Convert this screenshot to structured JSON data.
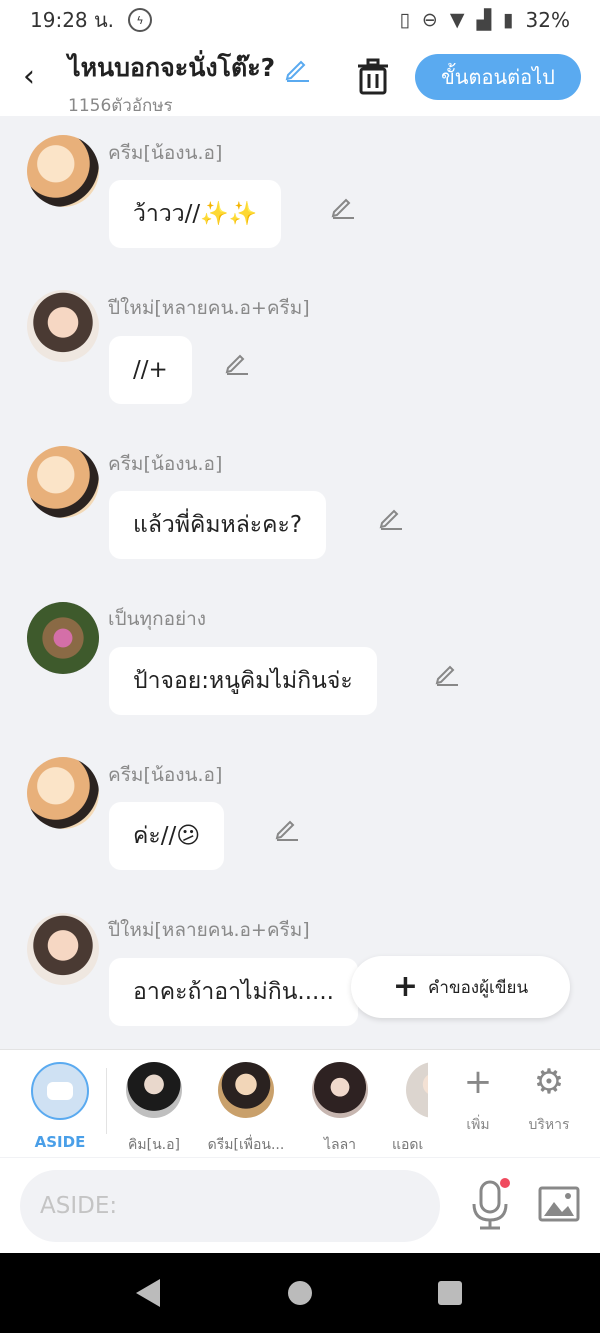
{
  "status_bar": {
    "time": "19:28 น.",
    "battery": "32%",
    "icons": [
      "messenger-icon",
      "vibrate-icon",
      "dnd-icon",
      "wifi-icon",
      "signal-icon",
      "battery-icon"
    ]
  },
  "header": {
    "title": "ไหนบอกจะนั่งโต๊ะ?",
    "char_count": "1156ตัวอักษร",
    "next_button": "ขั้นตอนต่อไป",
    "accent_color": "#5aaaf0"
  },
  "messages": [
    {
      "name": "ครีม[น้องน.อ]",
      "text": "ว้าวว//✨✨",
      "avatar": "cream"
    },
    {
      "name": "ปีใหม่[หลายคน.อ+ครีม]",
      "text": "//+",
      "avatar": "newyear"
    },
    {
      "name": "ครีม[น้องน.อ]",
      "text": "แล้วพี่คิมหล่ะคะ?",
      "avatar": "cream"
    },
    {
      "name": "เป็นทุกอย่าง",
      "text": "ป้าจอย:หนูคิมไม่กินจ่ะ",
      "avatar": "all"
    },
    {
      "name": "ครีม[น้องน.อ]",
      "text": "ค่ะ//😕",
      "avatar": "cream"
    },
    {
      "name": "ปีใหม่[หลายคน.อ+ครีม]",
      "text": "อาคะถ้าอาไม่กิน.....",
      "avatar": "newyear"
    }
  ],
  "author_button": {
    "label": "คำของผู้เขียน"
  },
  "character_bar": {
    "aside_label": "ASIDE",
    "characters": [
      {
        "label": "คิม[น.อ]"
      },
      {
        "label": "ดรีม[เพื่อน..."
      },
      {
        "label": "ไลลา"
      },
      {
        "label": "แอดเ"
      }
    ],
    "add_label": "เพิ่ม",
    "manage_label": "บริหาร"
  },
  "input": {
    "placeholder": "ASIDE:"
  }
}
